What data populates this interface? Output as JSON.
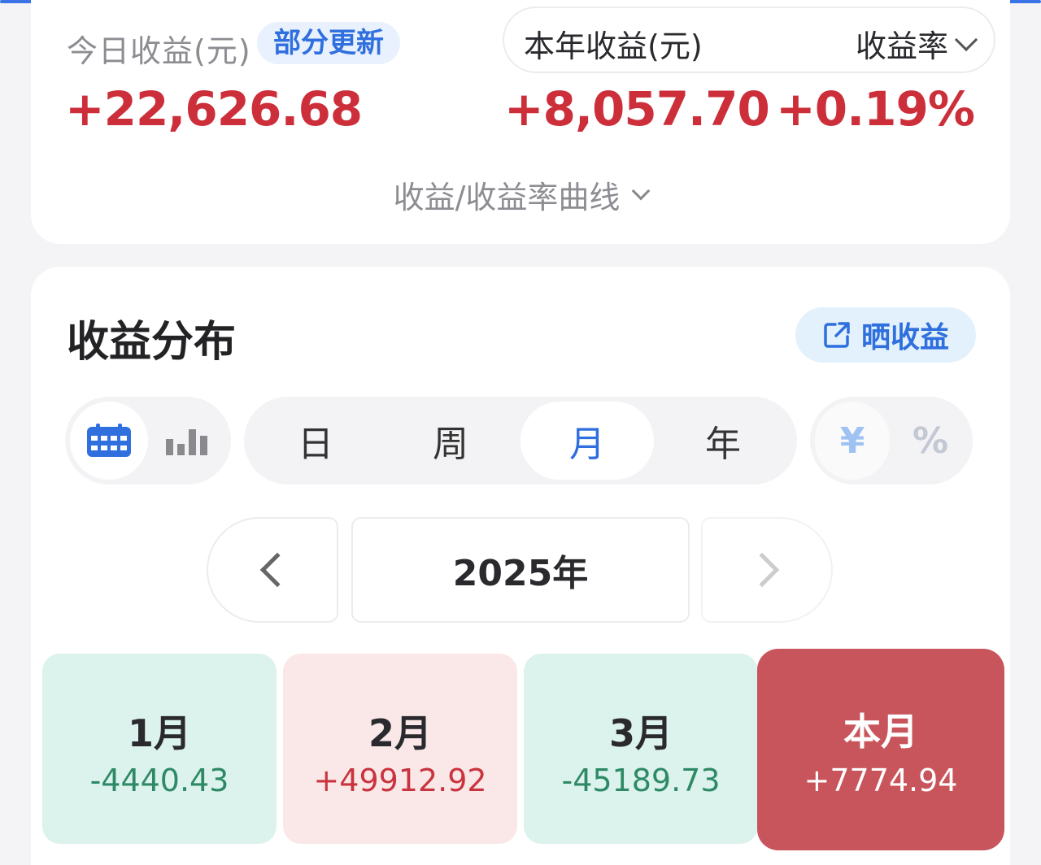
{
  "summary": {
    "today_label": "今日收益(元)",
    "partial_badge": "部分更新",
    "today_value": "+22,626.68",
    "year_label": "本年收益(元)",
    "rate_selector": "收益率",
    "year_value": "+8,057.70",
    "rate_value": "+0.19%",
    "curve_toggle": "收益/收益率曲线"
  },
  "distribution": {
    "title": "收益分布",
    "share_button": "晒收益",
    "view_modes": [
      {
        "icon": "calendar-icon",
        "active": true
      },
      {
        "icon": "bar-chart-icon",
        "active": false
      }
    ],
    "periods": [
      {
        "label": "日",
        "active": false
      },
      {
        "label": "周",
        "active": false
      },
      {
        "label": "月",
        "active": true
      },
      {
        "label": "年",
        "active": false
      }
    ],
    "units": [
      {
        "label": "¥",
        "active": true
      },
      {
        "label": "%",
        "active": false
      }
    ],
    "year": "2025年",
    "months": [
      {
        "name": "1月",
        "value": "-4440.43",
        "kind": "loss"
      },
      {
        "name": "2月",
        "value": "+49912.92",
        "kind": "gain"
      },
      {
        "name": "3月",
        "value": "-45189.73",
        "kind": "loss"
      },
      {
        "name": "本月",
        "value": "+7774.94",
        "kind": "current"
      }
    ]
  },
  "colors": {
    "accent_blue": "#2f6fde",
    "gain_red": "#cc2f3a",
    "loss_green": "#2e8a66",
    "current_month_bg": "#c9555c"
  }
}
